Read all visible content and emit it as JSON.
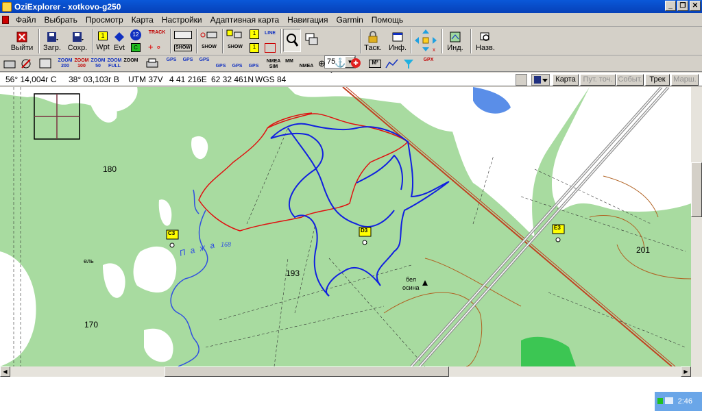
{
  "window": {
    "title": "OziExplorer - xotkovo-g250"
  },
  "menu": [
    "Файл",
    "Выбрать",
    "Просмотр",
    "Карта",
    "Настройки",
    "Адаптивная карта",
    "Навигация",
    "Garmin",
    "Помощь"
  ],
  "toolbar": {
    "exit": "Выйти",
    "load": "Загр.",
    "save": "Сохр.",
    "wpt": "Wpt",
    "evt": "Evt",
    "track": "TRACK",
    "show": "SHOW",
    "zoom_value": "75",
    "task": "Таск.",
    "info": "Инф.",
    "ind": "Инд.",
    "name": "Назв.",
    "wpt_num": "1",
    "evt_num": "12",
    "line": "LINE"
  },
  "toolbar2": {
    "zoom200": "ZOOM 200",
    "zoom100": "ZOOM 100",
    "zoom50": "ZOOM 50",
    "zoomfull": "ZOOM FULL",
    "zoom": "ZOOM",
    "gps": "GPS",
    "nmea_sim": "NMEA SIM",
    "mm": "MM",
    "nmea": "NMEA",
    "m2": "M²",
    "gpx": "GPX"
  },
  "coords": {
    "lat": "56° 14,004г С",
    "lon": "38° 03,103г В",
    "utm": "UTM  37V",
    "easting": "4 41 216E",
    "northing": "62 32 461N",
    "datum": "WGS 84"
  },
  "modes": [
    {
      "label": "Карта",
      "enabled": true
    },
    {
      "label": "Пут. точ.",
      "enabled": false
    },
    {
      "label": "Событ.",
      "enabled": false
    },
    {
      "label": "Трек",
      "enabled": true
    },
    {
      "label": "Марш.",
      "enabled": false
    }
  ],
  "map": {
    "waypoints": [
      "C3",
      "D3",
      "E3"
    ],
    "elevations": [
      "180",
      "193",
      "170",
      "201",
      "168"
    ],
    "river": "П а ж а",
    "labels": [
      "ель",
      "бел",
      "осина"
    ]
  },
  "tray": {
    "time": "2:46"
  },
  "colors": {
    "title": "#0a58d8",
    "map_green": "#a8dba0",
    "track_red": "#e01010",
    "track_blue": "#1020e0",
    "water": "#5a8ee8"
  }
}
